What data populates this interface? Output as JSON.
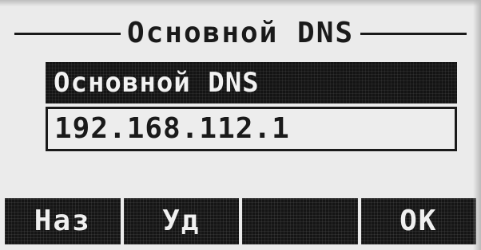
{
  "screen": {
    "title": "Основной DNS"
  },
  "field": {
    "label": "Основной DNS",
    "value": "192.168.112.1"
  },
  "softkeys": [
    {
      "label": "Наз"
    },
    {
      "label": "Уд"
    },
    {
      "label": ""
    },
    {
      "label": "OK"
    }
  ]
}
